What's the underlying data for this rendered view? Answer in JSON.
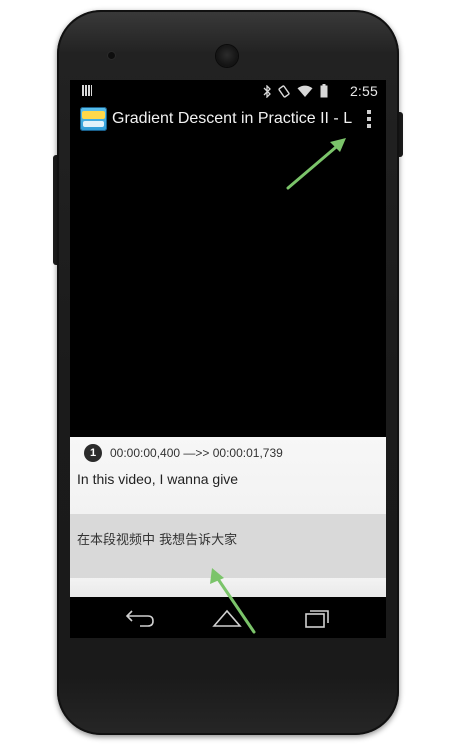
{
  "statusbar": {
    "time": "2:55",
    "icons": [
      "bluetooth-icon",
      "rotate-icon",
      "wifi-icon",
      "battery-icon"
    ]
  },
  "actionbar": {
    "title": "Gradient Descent in Practice II - L",
    "app_icon": "subtitle-app-icon",
    "overflow_icon": "overflow-menu-icon"
  },
  "subtitle": {
    "index": "1",
    "timecode": "00:00:00,400 —>> 00:00:01,739",
    "english": "In this video, I wanna give",
    "chinese": "在本段视频中 我想告诉大家"
  },
  "navbar": {
    "icons": [
      "back-icon",
      "home-icon",
      "recent-apps-icon"
    ]
  },
  "colors": {
    "annotation_arrow": "#7bc46a",
    "panel_bg": "#f2f2f2",
    "translation_bg": "#d9d9d9"
  }
}
